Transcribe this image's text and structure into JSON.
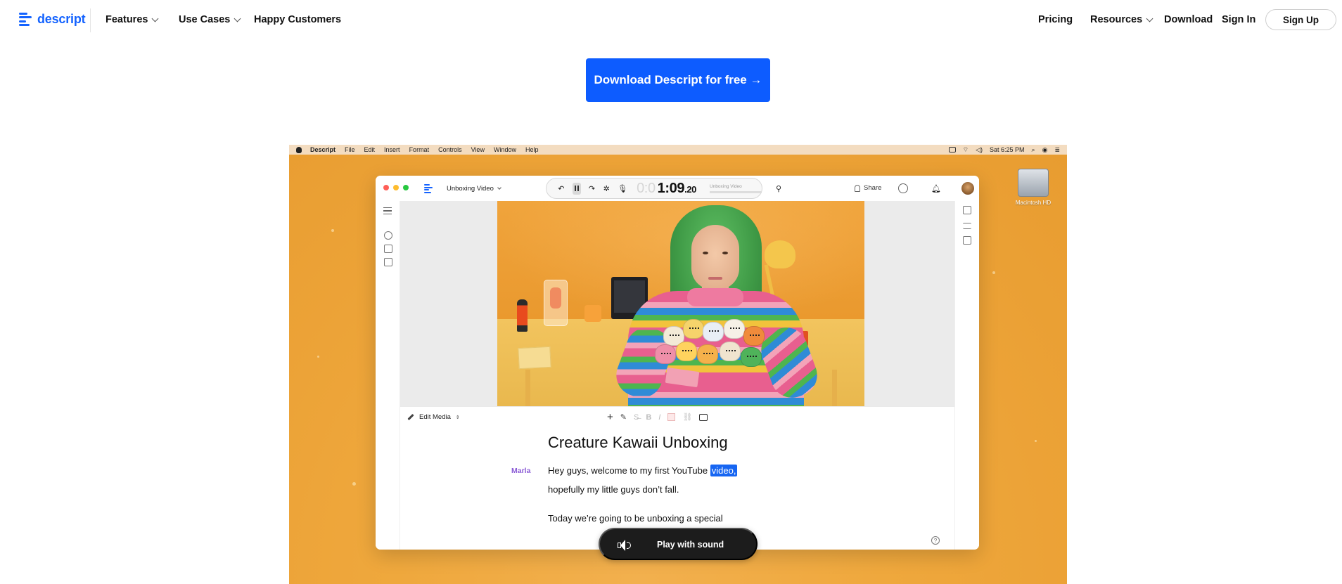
{
  "nav": {
    "brand": "descript",
    "left_items": [
      {
        "label": "Features",
        "has_dropdown": true
      },
      {
        "label": "Use Cases",
        "has_dropdown": true
      },
      {
        "label": "Happy Customers",
        "has_dropdown": false
      }
    ],
    "right_items": [
      {
        "label": "Pricing",
        "has_dropdown": false
      },
      {
        "label": "Resources",
        "has_dropdown": true
      },
      {
        "label": "Download",
        "has_dropdown": false
      },
      {
        "label": "Sign In",
        "has_dropdown": false
      }
    ],
    "signup_label": "Sign Up"
  },
  "cta": {
    "label": "Download Descript for free →"
  },
  "demo": {
    "menubar": {
      "app": "Descript",
      "items": [
        "File",
        "Edit",
        "Insert",
        "Format",
        "Controls",
        "View",
        "Window",
        "Help"
      ],
      "clock": "Sat 6:25 PM"
    },
    "desktop_icon_label": "Macintosh HD",
    "window": {
      "project_name": "Unboxing Video",
      "timecode": {
        "ghost": "0:0",
        "main": "1:09",
        "fraction": ".20"
      },
      "voice_label": "Unboxing Video",
      "share_label": "Share",
      "editor": {
        "edit_media_label": "Edit Media",
        "doc_title": "Creature Kawaii Unboxing",
        "speaker": "Marla",
        "line1_before": "Hey guys, welcome to my first YouTube ",
        "line1_highlight": "video,",
        "line2": "hopefully my little guys don’t fall.",
        "line3": "Today we’re going to be unboxing a special"
      }
    },
    "play_label": "Play with sound"
  },
  "colors": {
    "brand_blue": "#1463ff",
    "cta_blue": "#0d5cff",
    "speaker_purple": "#8b5cd6",
    "highlight_blue": "#1766f2",
    "demo_bg": "#efa83d"
  },
  "icons": [
    "descript-logo-icon",
    "chevron-down-icon",
    "apple-icon",
    "wifi-icon",
    "volume-icon",
    "search-icon",
    "undo-icon",
    "pause-icon",
    "redo-icon",
    "microphone-icon",
    "share-person-icon",
    "bell-icon",
    "pencil-icon",
    "plus-icon",
    "speaker-icon",
    "help-icon"
  ]
}
